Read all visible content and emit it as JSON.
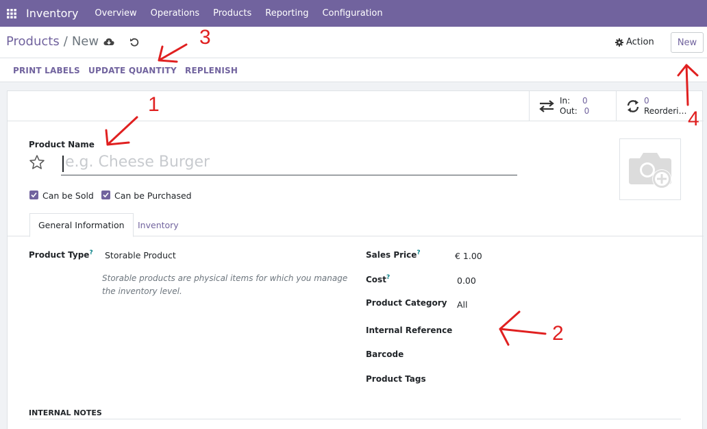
{
  "navbar": {
    "app_name": "Inventory",
    "menu": [
      "Overview",
      "Operations",
      "Products",
      "Reporting",
      "Configuration"
    ],
    "color": "#71639e"
  },
  "control_panel": {
    "breadcrumb_parent": "Products",
    "breadcrumb_separator": "/",
    "breadcrumb_current": "New",
    "action_label": "Action",
    "new_label": "New"
  },
  "status_buttons": [
    "PRINT LABELS",
    "UPDATE QUANTITY",
    "REPLENISH"
  ],
  "smart_buttons": {
    "in_label": "In:",
    "in_value": "0",
    "out_label": "Out:",
    "out_value": "0",
    "reorder_value": "0",
    "reorder_label": "Reorderi…"
  },
  "form": {
    "product_name_label": "Product Name",
    "product_name_placeholder": "e.g. Cheese Burger",
    "can_be_sold": "Can be Sold",
    "can_be_purchased": "Can be Purchased",
    "tabs": [
      "General Information",
      "Inventory"
    ],
    "product_type_label": "Product Type",
    "product_type_value": "Storable Product",
    "product_type_help": "Storable products are physical items for which you manage the inventory level.",
    "sales_price_label": "Sales Price",
    "sales_price_value": "€ 1.00",
    "cost_label": "Cost",
    "cost_value": "0.00",
    "category_label": "Product Category",
    "category_value": "All",
    "internal_ref_label": "Internal Reference",
    "barcode_label": "Barcode",
    "tags_label": "Product Tags",
    "internal_notes_label": "INTERNAL NOTES",
    "tooltip_mark": "?"
  },
  "annotations": [
    "1",
    "2",
    "3",
    "4"
  ]
}
